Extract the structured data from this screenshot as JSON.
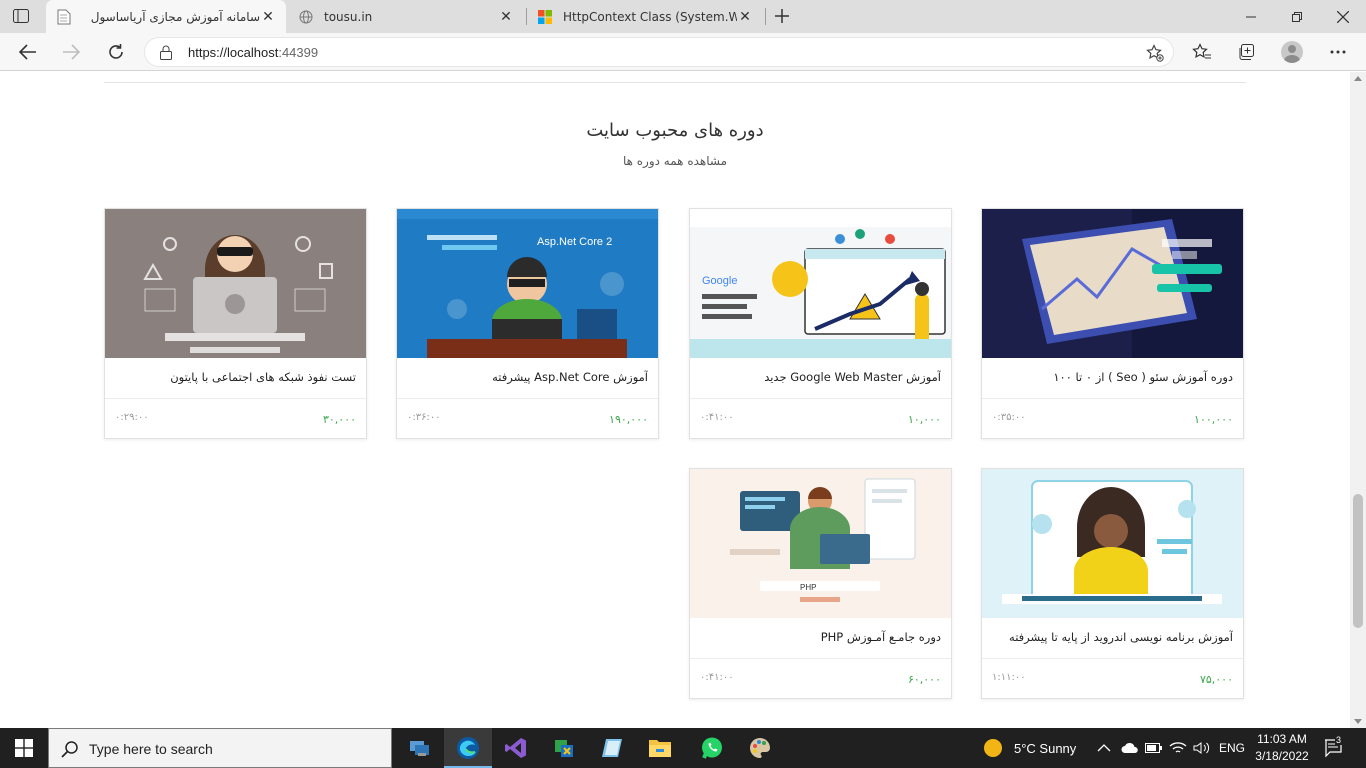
{
  "browser": {
    "tabs": [
      {
        "title": "سامانه آموزش مجازی آریاساسول",
        "active": true
      },
      {
        "title": "tousu.in",
        "active": false
      },
      {
        "title": "HttpContext Class (System.Web)",
        "active": false
      }
    ],
    "address": {
      "scheme_host": "https://localhost",
      "port": ":44399"
    }
  },
  "page": {
    "section_title": "دوره های محبوب سایت",
    "section_subtitle": "مشاهده همه دوره ها",
    "courses": [
      {
        "title": "دوره آموزش سئو ( Seo ) از ۰ تا ۱۰۰",
        "price": "۱۰۰,۰۰۰",
        "duration": "۰:۳۵:۰۰",
        "image": "seo-laptop-thumbnail"
      },
      {
        "title": "آموزش Google Web Master جدید",
        "price": "۱۰,۰۰۰",
        "duration": "۰:۴۱:۰۰",
        "image": "google-webmaster-thumbnail"
      },
      {
        "title": "آموزش Asp.Net Core پیشرفته",
        "price": "۱۹۰,۰۰۰",
        "duration": "۰:۳۶:۰۰",
        "image": "aspnet-core-thumbnail"
      },
      {
        "title": "تست نفوذ شبکه های اجتماعی با پایتون",
        "price": "۳۰,۰۰۰",
        "duration": "۰:۲۹:۰۰",
        "image": "hacker-thumbnail"
      },
      {
        "title": "آموزش برنامه نویسی اندروید از پایه تا پیشرفته",
        "price": "۷۵,۰۰۰",
        "duration": "۱:۱۱:۰۰",
        "image": "android-thumbnail"
      },
      {
        "title": "دوره جامـع آمـوزش PHP",
        "price": "۶۰,۰۰۰",
        "duration": "۰:۴۱:۰۰",
        "image": "php-thumbnail"
      }
    ]
  },
  "taskbar": {
    "search_placeholder": "Type here to search",
    "weather": "5°C  Sunny",
    "language": "ENG",
    "time": "11:03 AM",
    "date": "3/18/2022",
    "notification_count": "3"
  },
  "colors": {
    "price_green": "#3aa64a",
    "edge_blue": "#0c59a4",
    "taskbar": "#202020"
  }
}
